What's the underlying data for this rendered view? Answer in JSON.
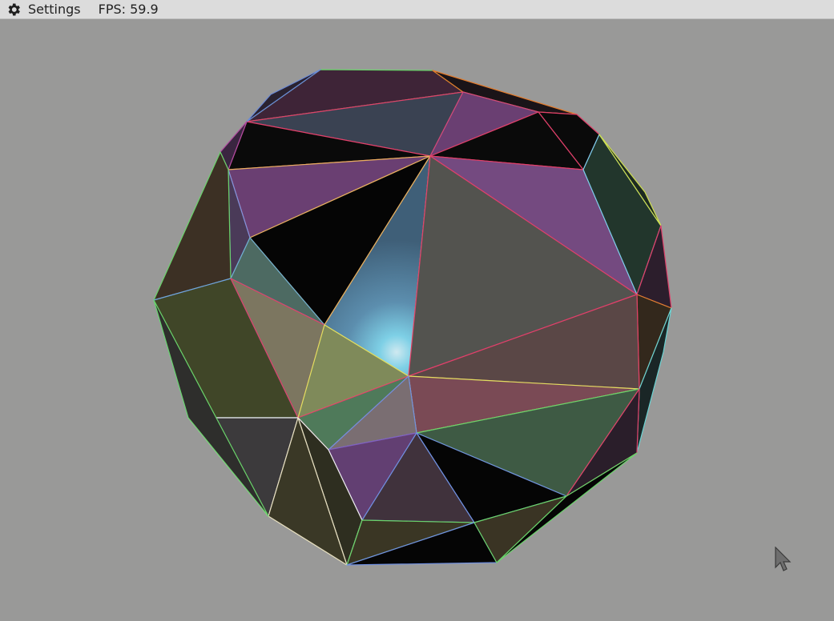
{
  "menubar": {
    "settings_label": "Settings",
    "fps_text": "FPS: 59.9",
    "settings_icon": "gear-icon"
  },
  "scene": {
    "background": "#999998",
    "object": "faceted-sphere-mesh",
    "cursor_icon": "mouse-pointer-icon"
  }
}
